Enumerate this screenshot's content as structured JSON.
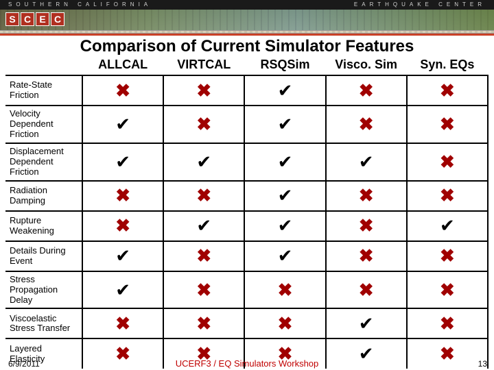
{
  "banner": {
    "left_text": "SOUTHERN CALIFORNIA",
    "right_text": "EARTHQUAKE CENTER",
    "logo": [
      "S",
      "C",
      "E",
      "C"
    ]
  },
  "title": "Comparison of Current Simulator Features",
  "columns": [
    "ALLCAL",
    "VIRTCAL",
    "RSQSim",
    "Visco. Sim",
    "Syn. EQs"
  ],
  "rows": [
    {
      "label": "Rate-State Friction",
      "cells": [
        false,
        false,
        true,
        false,
        false
      ]
    },
    {
      "label": "Velocity Dependent Friction",
      "cells": [
        true,
        false,
        true,
        false,
        false
      ]
    },
    {
      "label": "Displacement Dependent Friction",
      "cells": [
        true,
        true,
        true,
        true,
        false
      ]
    },
    {
      "label": "Radiation Damping",
      "cells": [
        false,
        false,
        true,
        false,
        false
      ]
    },
    {
      "label": "Rupture Weakening",
      "cells": [
        false,
        true,
        true,
        false,
        true
      ]
    },
    {
      "label": "Details During Event",
      "cells": [
        true,
        false,
        true,
        false,
        false
      ]
    },
    {
      "label": "Stress Propagation Delay",
      "cells": [
        true,
        false,
        false,
        false,
        false
      ]
    },
    {
      "label": "Viscoelastic Stress Transfer",
      "cells": [
        false,
        false,
        false,
        true,
        false
      ]
    },
    {
      "label": "Layered Elasticity",
      "cells": [
        false,
        false,
        false,
        true,
        false
      ]
    }
  ],
  "glyphs": {
    "true": "✔",
    "false": "✖"
  },
  "footer": {
    "date": "6/9/2011",
    "center": "UCERF3 / EQ Simulators Workshop",
    "page": "13"
  }
}
